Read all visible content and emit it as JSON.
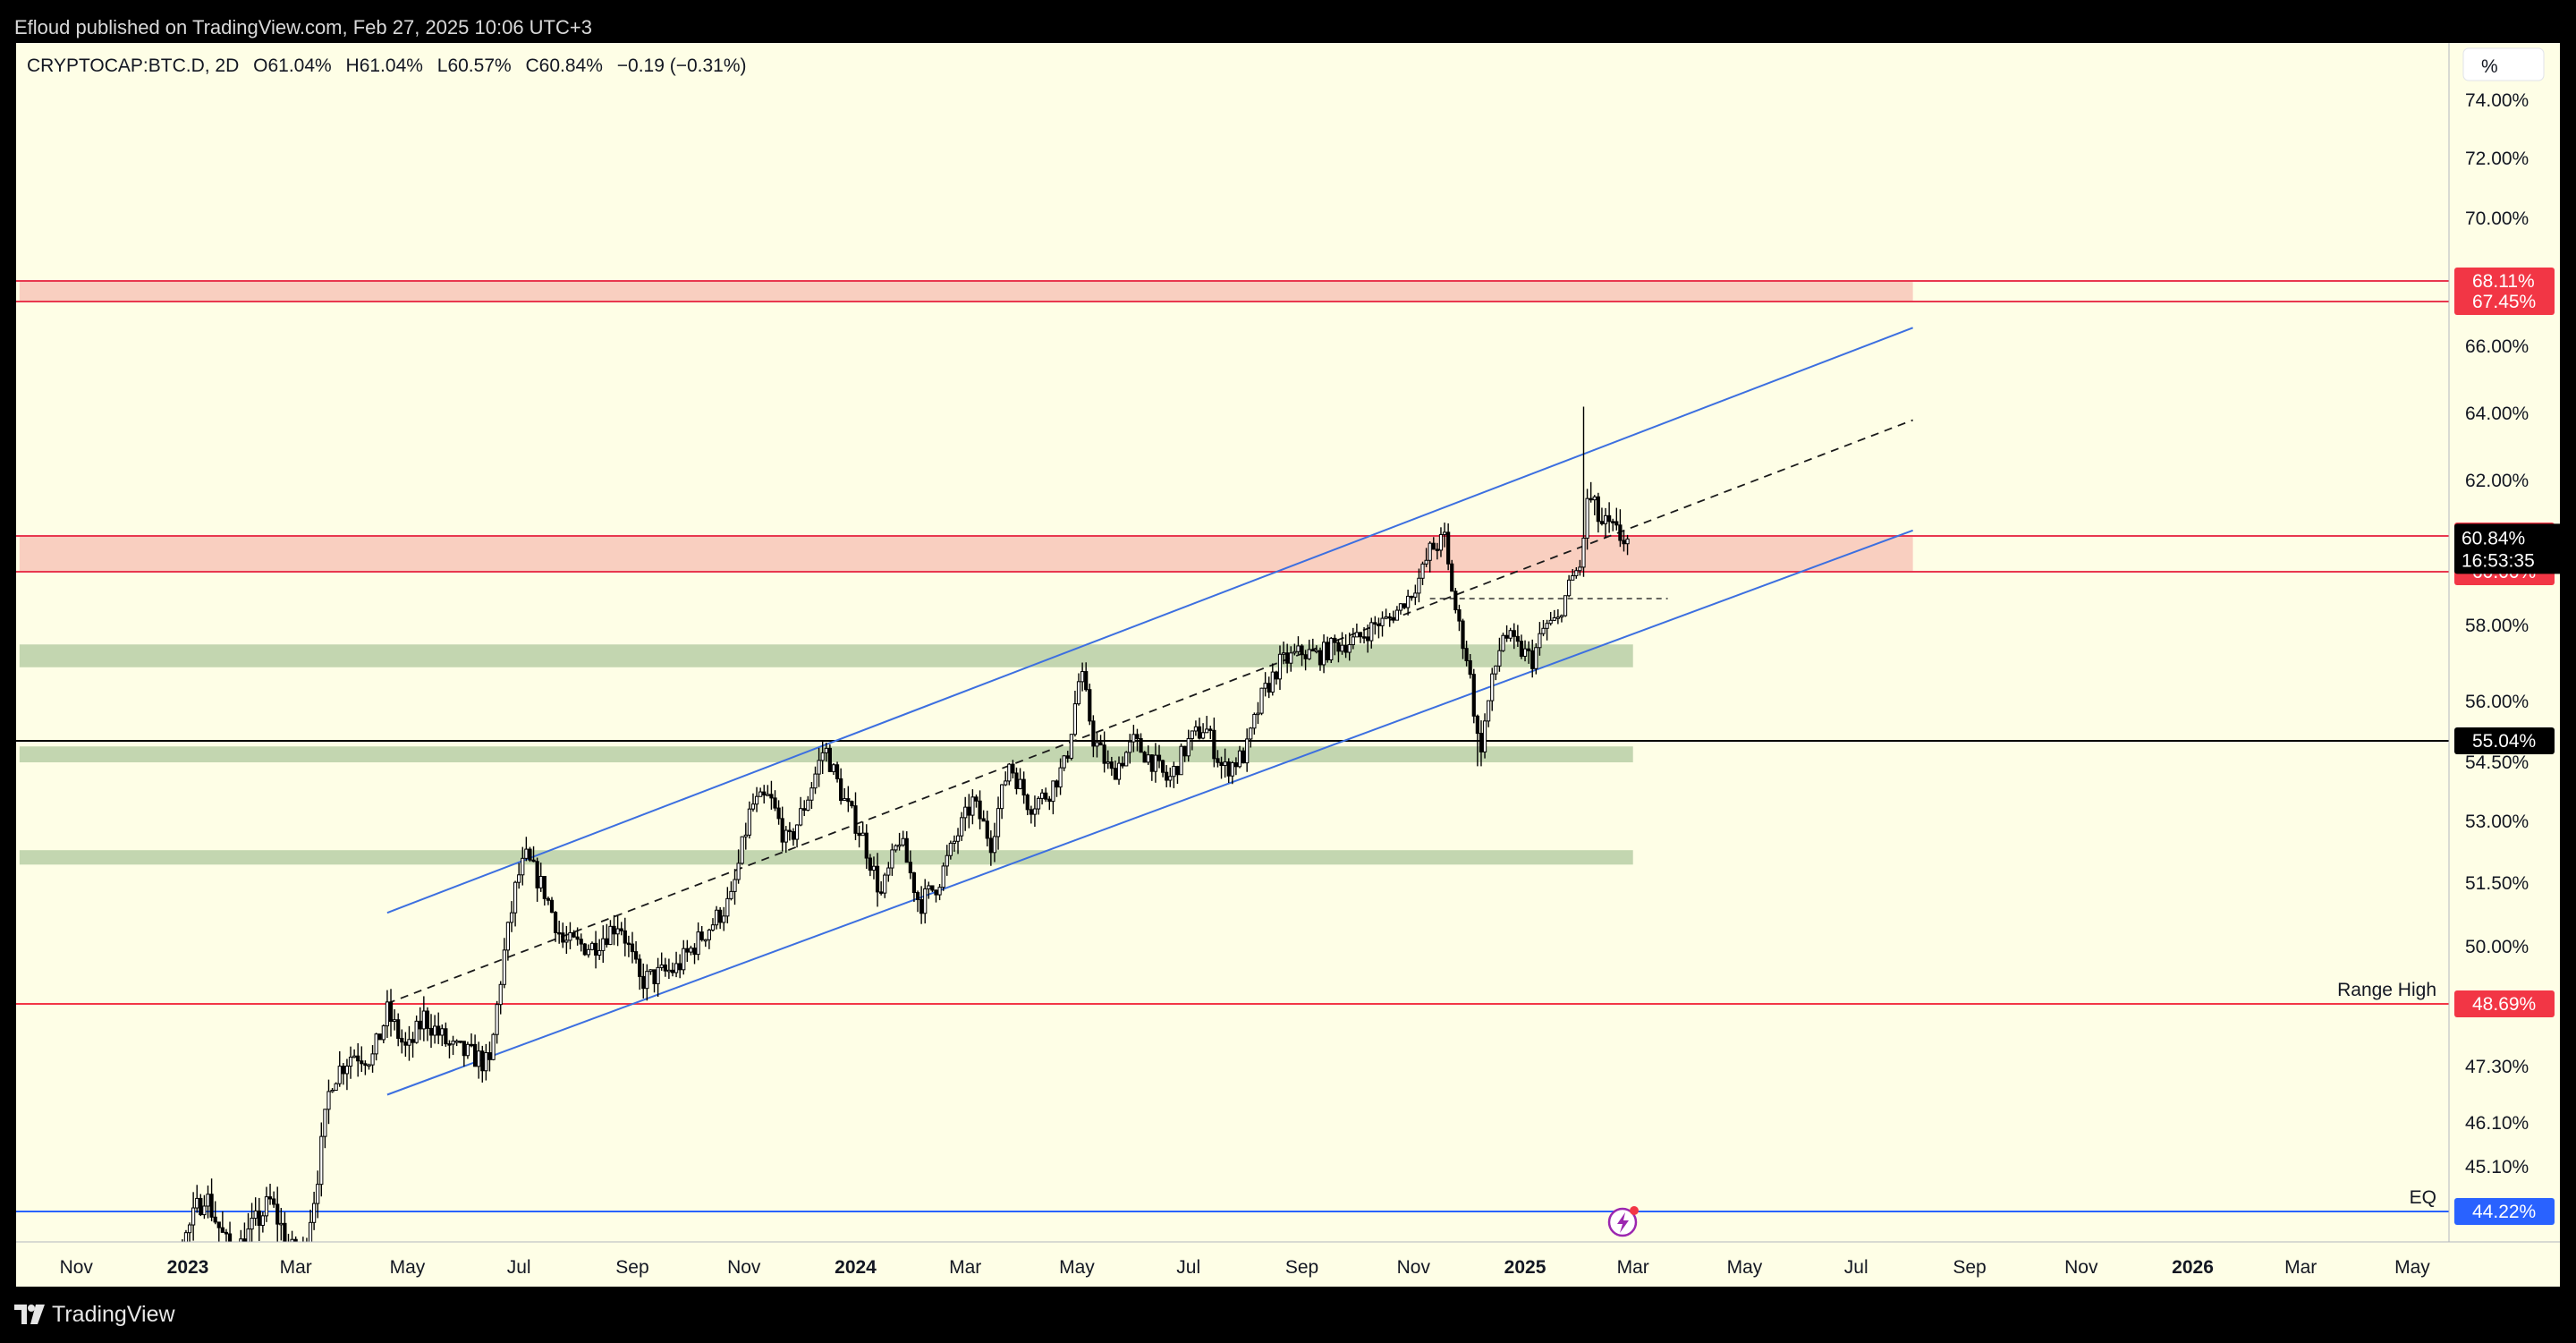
{
  "publish_note": "Efloud published on TradingView.com, Feb 27, 2025 10:06 UTC+3",
  "brand": "TradingView",
  "legend": {
    "symbol": "CRYPTOCAP:BTC.D, 2D",
    "open": "O61.04%",
    "high": "H61.04%",
    "low": "L60.57%",
    "close": "C60.84%",
    "change": "−0.19 (−0.31%)"
  },
  "colors": {
    "background": "#fefee6",
    "candle": "#000000",
    "channel": "#3c6fe0",
    "resistance_zone": "#f9cfc0",
    "resistance_line": "#e8384f",
    "support_zone": "#c3d6b0",
    "eq_line": "#2962ff"
  },
  "chart_data": {
    "type": "candlestick",
    "ylabel_unit": "%",
    "y_axis_labels": [
      "74.00%",
      "72.00%",
      "70.00%",
      "66.00%",
      "64.00%",
      "62.00%",
      "58.00%",
      "56.00%",
      "54.50%",
      "53.00%",
      "51.50%",
      "50.00%",
      "47.30%",
      "46.10%",
      "45.10%"
    ],
    "x_axis_labels": [
      {
        "label": "Nov",
        "year": false
      },
      {
        "label": "2023",
        "year": true
      },
      {
        "label": "Mar",
        "year": false
      },
      {
        "label": "May",
        "year": false
      },
      {
        "label": "Jul",
        "year": false
      },
      {
        "label": "Sep",
        "year": false
      },
      {
        "label": "Nov",
        "year": false
      },
      {
        "label": "2024",
        "year": true
      },
      {
        "label": "Mar",
        "year": false
      },
      {
        "label": "May",
        "year": false
      },
      {
        "label": "Jul",
        "year": false
      },
      {
        "label": "Sep",
        "year": false
      },
      {
        "label": "Nov",
        "year": false
      },
      {
        "label": "2025",
        "year": true
      },
      {
        "label": "Mar",
        "year": false
      },
      {
        "label": "May",
        "year": false
      },
      {
        "label": "Jul",
        "year": false
      },
      {
        "label": "Sep",
        "year": false
      },
      {
        "label": "Nov",
        "year": false
      },
      {
        "label": "2026",
        "year": true
      },
      {
        "label": "Mar",
        "year": false
      },
      {
        "label": "May",
        "year": false
      }
    ],
    "price_badges": [
      {
        "text": "68.11%",
        "value": 68.11,
        "bg": "#f23645"
      },
      {
        "text": "67.45%",
        "value": 67.45,
        "bg": "#f23645"
      },
      {
        "text": "61.00%",
        "value": 61.0,
        "bg": "#f23645"
      },
      {
        "text": "60.00%",
        "value": 60.0,
        "bg": "#f23645"
      },
      {
        "text": "55.04%",
        "value": 55.04,
        "bg": "#000000"
      },
      {
        "text": "48.69%",
        "value": 48.69,
        "bg": "#f23645"
      },
      {
        "text": "44.22%",
        "value": 44.22,
        "bg": "#2962ff"
      }
    ],
    "last_price": {
      "value": 60.84,
      "text": "60.84%",
      "countdown": "16:53:35"
    },
    "annotations": [
      {
        "text": "Range High",
        "value": 48.69
      },
      {
        "text": "EQ",
        "value": 44.22
      }
    ],
    "resistance_zones": [
      {
        "from": 67.45,
        "to": 68.11,
        "start": "2022-10-01",
        "end": "2025-08-01"
      },
      {
        "from": 60.0,
        "to": 61.0,
        "start": "2022-10-01",
        "end": "2025-08-01"
      }
    ],
    "support_zones": [
      {
        "from": 56.9,
        "to": 57.5,
        "start": "2022-10-01",
        "end": "2025-03-01"
      },
      {
        "from": 54.5,
        "to": 54.9,
        "start": "2022-10-01",
        "end": "2025-03-01"
      },
      {
        "from": 51.95,
        "to": 52.3,
        "start": "2022-10-01",
        "end": "2025-03-01"
      }
    ],
    "horizontal_lines": [
      {
        "value": 55.04,
        "color": "#000000"
      },
      {
        "value": 48.69,
        "color": "#f23645"
      },
      {
        "value": 44.22,
        "color": "#2962ff"
      }
    ],
    "channel": {
      "upper": [
        {
          "date": "2023-04-20",
          "value": 50.8
        },
        {
          "date": "2025-08-01",
          "value": 66.6
        }
      ],
      "mid": [
        {
          "date": "2023-04-20",
          "value": 48.7
        },
        {
          "date": "2025-08-01",
          "value": 63.8
        }
      ],
      "lower": [
        {
          "date": "2023-04-20",
          "value": 46.7
        },
        {
          "date": "2025-08-01",
          "value": 61.1
        }
      ]
    },
    "small_dashed_level": {
      "value": 59.0,
      "start": "2024-11-10",
      "end": "2025-03-20"
    },
    "close_path": [
      {
        "date": "2022-11-01",
        "value": 42.5
      },
      {
        "date": "2022-12-18",
        "value": 42.6
      },
      {
        "date": "2023-01-10",
        "value": 44.6
      },
      {
        "date": "2023-01-25",
        "value": 43.3
      },
      {
        "date": "2023-02-15",
        "value": 44.4
      },
      {
        "date": "2023-03-03",
        "value": 43.1
      },
      {
        "date": "2023-03-12",
        "value": 44.7
      },
      {
        "date": "2023-03-20",
        "value": 47.0
      },
      {
        "date": "2023-04-01",
        "value": 47.6
      },
      {
        "date": "2023-04-12",
        "value": 47.5
      },
      {
        "date": "2023-04-20",
        "value": 48.5
      },
      {
        "date": "2023-05-01",
        "value": 47.6
      },
      {
        "date": "2023-05-10",
        "value": 48.4
      },
      {
        "date": "2023-05-25",
        "value": 47.7
      },
      {
        "date": "2023-06-08",
        "value": 47.5
      },
      {
        "date": "2023-06-15",
        "value": 47.3
      },
      {
        "date": "2023-06-22",
        "value": 49.6
      },
      {
        "date": "2023-06-30",
        "value": 51.6
      },
      {
        "date": "2023-07-05",
        "value": 52.1
      },
      {
        "date": "2023-07-15",
        "value": 51.3
      },
      {
        "date": "2023-07-25",
        "value": 50.1
      },
      {
        "date": "2023-08-10",
        "value": 50.0
      },
      {
        "date": "2023-08-25",
        "value": 50.6
      },
      {
        "date": "2023-09-05",
        "value": 49.2
      },
      {
        "date": "2023-09-25",
        "value": 49.5
      },
      {
        "date": "2023-10-10",
        "value": 50.3
      },
      {
        "date": "2023-10-25",
        "value": 51.1
      },
      {
        "date": "2023-11-05",
        "value": 53.4
      },
      {
        "date": "2023-11-15",
        "value": 53.6
      },
      {
        "date": "2023-11-25",
        "value": 52.4
      },
      {
        "date": "2023-12-05",
        "value": 53.5
      },
      {
        "date": "2023-12-15",
        "value": 54.9
      },
      {
        "date": "2023-12-25",
        "value": 53.6
      },
      {
        "date": "2024-01-05",
        "value": 52.6
      },
      {
        "date": "2024-01-15",
        "value": 51.2
      },
      {
        "date": "2024-01-25",
        "value": 52.6
      },
      {
        "date": "2024-02-05",
        "value": 51.0
      },
      {
        "date": "2024-02-15",
        "value": 51.5
      },
      {
        "date": "2024-02-25",
        "value": 52.6
      },
      {
        "date": "2024-03-05",
        "value": 53.5
      },
      {
        "date": "2024-03-15",
        "value": 52.5
      },
      {
        "date": "2024-03-25",
        "value": 54.5
      },
      {
        "date": "2024-04-05",
        "value": 53.4
      },
      {
        "date": "2024-04-15",
        "value": 53.7
      },
      {
        "date": "2024-04-25",
        "value": 54.5
      },
      {
        "date": "2024-05-03",
        "value": 56.8
      },
      {
        "date": "2024-05-10",
        "value": 55.1
      },
      {
        "date": "2024-05-20",
        "value": 54.2
      },
      {
        "date": "2024-06-01",
        "value": 55.0
      },
      {
        "date": "2024-06-10",
        "value": 54.6
      },
      {
        "date": "2024-06-20",
        "value": 54.0
      },
      {
        "date": "2024-07-01",
        "value": 55.0
      },
      {
        "date": "2024-07-10",
        "value": 55.4
      },
      {
        "date": "2024-07-20",
        "value": 54.3
      },
      {
        "date": "2024-08-01",
        "value": 54.7
      },
      {
        "date": "2024-08-10",
        "value": 56.1
      },
      {
        "date": "2024-08-20",
        "value": 57.0
      },
      {
        "date": "2024-09-01",
        "value": 57.3
      },
      {
        "date": "2024-09-10",
        "value": 57.2
      },
      {
        "date": "2024-09-20",
        "value": 57.5
      },
      {
        "date": "2024-10-01",
        "value": 57.6
      },
      {
        "date": "2024-10-10",
        "value": 58.0
      },
      {
        "date": "2024-10-20",
        "value": 58.3
      },
      {
        "date": "2024-11-01",
        "value": 59.3
      },
      {
        "date": "2024-11-10",
        "value": 60.6
      },
      {
        "date": "2024-11-18",
        "value": 60.9
      },
      {
        "date": "2024-11-25",
        "value": 58.2
      },
      {
        "date": "2024-12-01",
        "value": 57.0
      },
      {
        "date": "2024-12-07",
        "value": 54.7
      },
      {
        "date": "2024-12-14",
        "value": 56.5
      },
      {
        "date": "2024-12-20",
        "value": 57.8
      },
      {
        "date": "2024-12-28",
        "value": 57.4
      },
      {
        "date": "2025-01-05",
        "value": 57.1
      },
      {
        "date": "2025-01-12",
        "value": 58.0
      },
      {
        "date": "2025-01-19",
        "value": 58.2
      },
      {
        "date": "2025-01-26",
        "value": 59.7
      },
      {
        "date": "2025-02-01",
        "value": 60.3
      },
      {
        "date": "2025-02-04",
        "value": 61.7
      },
      {
        "date": "2025-02-12",
        "value": 61.2
      },
      {
        "date": "2025-02-20",
        "value": 61.0
      },
      {
        "date": "2025-02-27",
        "value": 60.84
      }
    ]
  }
}
